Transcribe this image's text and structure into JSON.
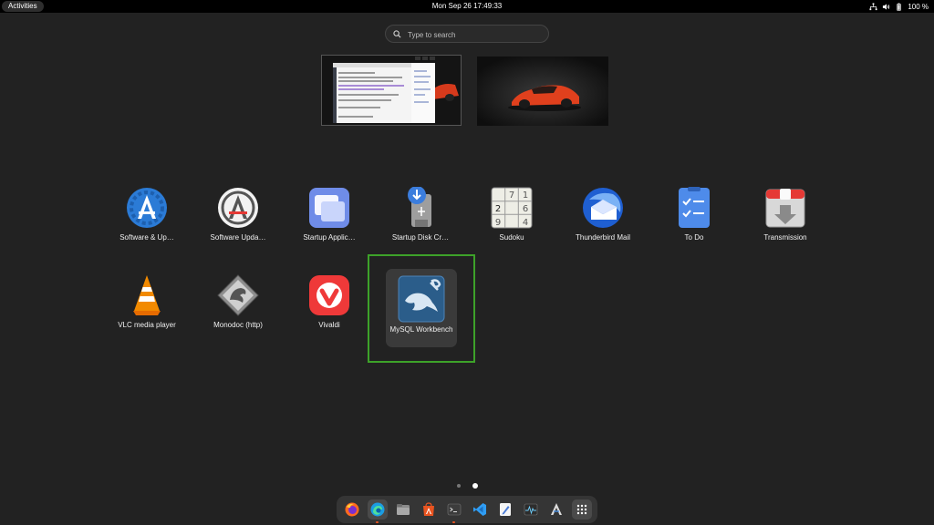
{
  "topbar": {
    "activities": "Activities",
    "datetime": "Mon Sep 26  17:49:33",
    "battery": "100 %"
  },
  "search": {
    "placeholder": "Type to search"
  },
  "apps": [
    {
      "label": "Software & Up…",
      "icon": "software-properties-icon"
    },
    {
      "label": "Software Upda…",
      "icon": "software-updater-icon"
    },
    {
      "label": "Startup Applic…",
      "icon": "startup-applications-icon"
    },
    {
      "label": "Startup Disk Cr…",
      "icon": "startup-disk-creator-icon"
    },
    {
      "label": "Sudoku",
      "icon": "sudoku-icon"
    },
    {
      "label": "Thunderbird Mail",
      "icon": "thunderbird-icon"
    },
    {
      "label": "To Do",
      "icon": "todo-icon"
    },
    {
      "label": "Transmission",
      "icon": "transmission-icon"
    },
    {
      "label": "VLC media player",
      "icon": "vlc-icon"
    },
    {
      "label": "Monodoc (http)",
      "icon": "monodoc-icon"
    },
    {
      "label": "Vivaldi",
      "icon": "vivaldi-icon"
    },
    {
      "label": "MySQL Workbench",
      "icon": "mysql-workbench-icon"
    }
  ],
  "sudoku_digits": [
    "7",
    "1",
    "2",
    "6",
    "9",
    "4"
  ],
  "dock": [
    {
      "icon": "firefox-icon",
      "running": false
    },
    {
      "icon": "edge-icon",
      "running": true
    },
    {
      "icon": "files-icon",
      "running": false
    },
    {
      "icon": "app-center-icon",
      "running": false
    },
    {
      "icon": "terminal-icon",
      "running": true
    },
    {
      "icon": "vscode-icon",
      "running": false
    },
    {
      "icon": "text-editor-icon",
      "running": false
    },
    {
      "icon": "system-monitor-icon",
      "running": false
    },
    {
      "icon": "app-installer-icon",
      "running": false
    },
    {
      "icon": "show-apps-icon",
      "running": false
    }
  ],
  "colors": {
    "focus": "#3da229",
    "running": "#e95420"
  }
}
